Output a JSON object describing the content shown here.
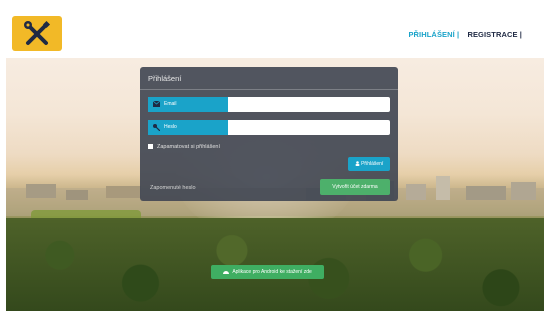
{
  "header": {
    "logo_icon": "wrench-screwdriver-icon",
    "nav": {
      "login": "PŘIHLÁŠENÍ |",
      "register": "REGISTRACE |"
    }
  },
  "login_panel": {
    "title": "Přihlášení",
    "email_label": "Email",
    "password_label": "Heslo",
    "remember_label": "Zapamatovat si přihlášení",
    "login_button": "Přihlášení",
    "forgot_link": "Zapomenuté heslo",
    "create_button": "Vytvořit účet zdarma"
  },
  "android_button": "Aplikace pro Android ke stažení zde",
  "colors": {
    "accent": "#1aa3c9",
    "green": "#4db06b",
    "logo_bg": "#f2b927"
  }
}
